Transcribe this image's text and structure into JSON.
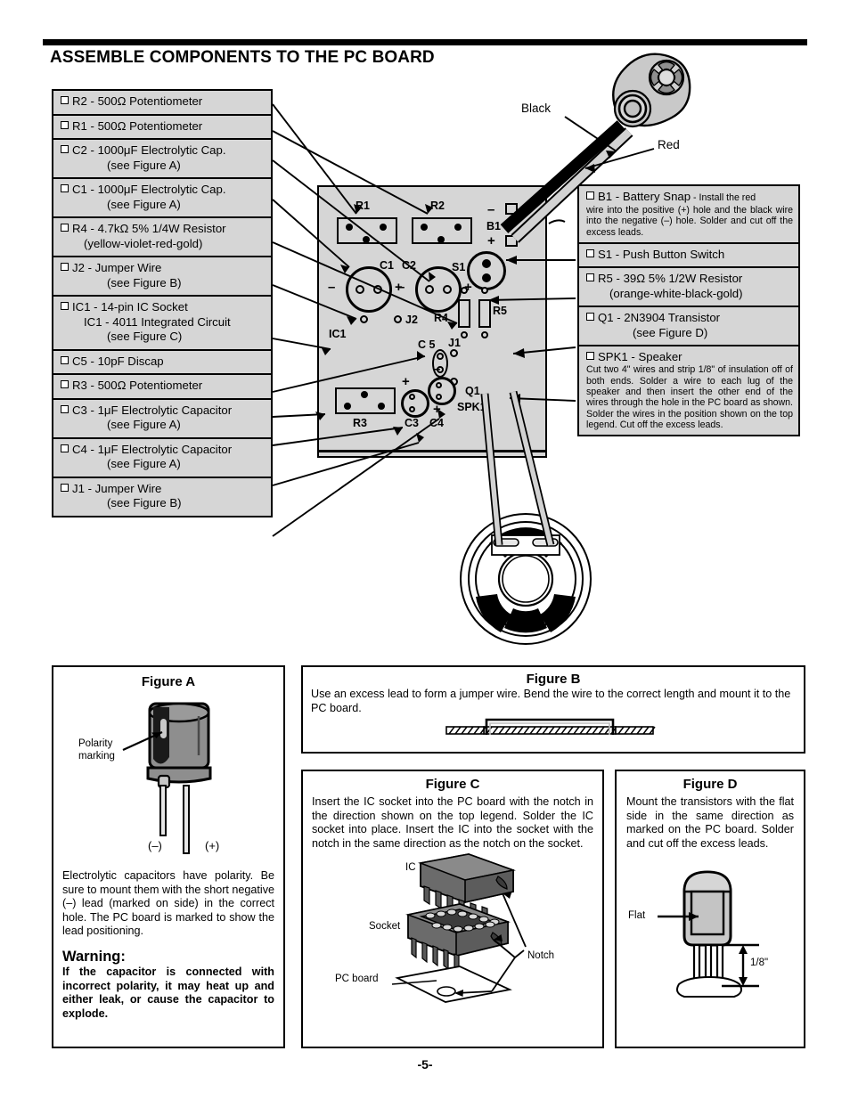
{
  "page": {
    "title": "ASSEMBLE COMPONENTS TO THE PC BOARD",
    "page_number": "-5-",
    "colors": {
      "panel_fill": "#d6d6d6",
      "ink": "#000000",
      "paper": "#ffffff"
    }
  },
  "checklist_left": [
    {
      "lines": [
        "R2 - 500Ω Potentiometer"
      ],
      "indents": [
        0
      ]
    },
    {
      "lines": [
        "R1 - 500Ω Potentiometer"
      ],
      "indents": [
        0
      ]
    },
    {
      "lines": [
        "C2 - 1000μF Electrolytic Cap.",
        "(see Figure A)"
      ],
      "indents": [
        0,
        2
      ]
    },
    {
      "lines": [
        "C1 - 1000μF Electrolytic Cap.",
        "(see Figure A)"
      ],
      "indents": [
        0,
        2
      ]
    },
    {
      "lines": [
        "R4 - 4.7kΩ 5% 1/4W Resistor",
        "(yellow-violet-red-gold)"
      ],
      "indents": [
        0,
        1
      ]
    },
    {
      "lines": [
        "J2 - Jumper Wire",
        "(see Figure B)"
      ],
      "indents": [
        0,
        2
      ]
    },
    {
      "lines": [
        "IC1 - 14-pin IC Socket",
        "IC1 - 4011 Integrated Circuit",
        "(see Figure C)"
      ],
      "indents": [
        0,
        1,
        2
      ]
    },
    {
      "lines": [
        "C5 - 10pF Discap"
      ],
      "indents": [
        0
      ]
    },
    {
      "lines": [
        "R3 - 500Ω Potentiometer"
      ],
      "indents": [
        0
      ]
    },
    {
      "lines": [
        "C3 - 1μF Electrolytic Capacitor",
        "(see Figure A)"
      ],
      "indents": [
        0,
        2
      ]
    },
    {
      "lines": [
        "C4 - 1μF Electrolytic Capacitor",
        "(see Figure A)"
      ],
      "indents": [
        0,
        2
      ]
    },
    {
      "lines": [
        "J1 - Jumper Wire",
        "(see Figure B)"
      ],
      "indents": [
        0,
        2
      ]
    }
  ],
  "checklist_right": [
    {
      "heading": "B1 - Battery Snap",
      "heading_suffix": " - Install the red",
      "paragraph": "wire into the positive (+) hole and the black wire into the negative (–) hole. Solder and cut off the excess leads."
    },
    {
      "lines": [
        "S1 - Push Button Switch"
      ],
      "indents": [
        0
      ]
    },
    {
      "lines": [
        "R5 - 39Ω 5% 1/2W Resistor",
        "(orange-white-black-gold)"
      ],
      "indents": [
        0,
        1
      ]
    },
    {
      "lines": [
        "Q1 - 2N3904 Transistor",
        "(see Figure D)"
      ],
      "indents": [
        0,
        2
      ]
    },
    {
      "heading": "SPK1 - Speaker",
      "paragraph": "Cut two 4\" wires and strip 1/8\" of insulation off of both ends. Solder a wire to each lug of the speaker and then insert the other end of the wires through the hole in the PC board as shown. Solder the wires in the position shown on the top legend. Cut off the excess leads."
    }
  ],
  "battery_snap": {
    "black_label": "Black",
    "red_label": "Red"
  },
  "board_legend": {
    "r1": "R1",
    "r2": "R2",
    "r3": "R3",
    "r4": "R4",
    "r5": "R5",
    "c1": "C1",
    "c2": "C2",
    "c3": "C3",
    "c4": "C4",
    "c5": "C 5",
    "ic1": "IC1",
    "j1": "J1",
    "j2": "J2",
    "b1": "B1",
    "s1": "S1",
    "q1": "Q1",
    "spk1": "SPK1",
    "c1_minus": "–",
    "c1_plus": "+",
    "c2_minus": "–",
    "c2_plus": "+",
    "c3_plus": "+",
    "c4_minus": "–",
    "c4_plus": "+",
    "b1_minus": "–",
    "b1_plus": "+"
  },
  "figure_a": {
    "title": "Figure A",
    "callout": "Polarity\nmarking",
    "callout_line1": "Polarity",
    "callout_line2": "marking",
    "lead_minus": "(–)",
    "lead_plus": "(+)",
    "body": "Electrolytic capacitors have polarity. Be sure to mount them with the short negative (–) lead (marked on side) in the correct hole. The PC board is marked to show the lead positioning.",
    "warning_heading": "Warning:",
    "warning_body": "If the capacitor is connected with incorrect polarity, it may heat up and either leak, or cause the capacitor to explode."
  },
  "figure_b": {
    "title": "Figure B",
    "body": "Use an excess lead to form a jumper wire. Bend the wire to the correct length and mount it to the PC board."
  },
  "figure_c": {
    "title": "Figure C",
    "body": "Insert the IC socket into the PC board with the notch in the direction shown on the top legend.  Solder the IC socket into place.  Insert the IC into the socket with the notch in the same direction as the notch on the socket.",
    "label_ic": "IC",
    "label_socket": "Socket",
    "label_pcboard": "PC board",
    "label_notch": "Notch"
  },
  "figure_d": {
    "title": "Figure D",
    "body": "Mount the transistors with the flat side in the same direction as marked on the PC board.  Solder and cut off the excess leads.",
    "label_flat": "Flat",
    "label_dimension": "1/8\""
  }
}
